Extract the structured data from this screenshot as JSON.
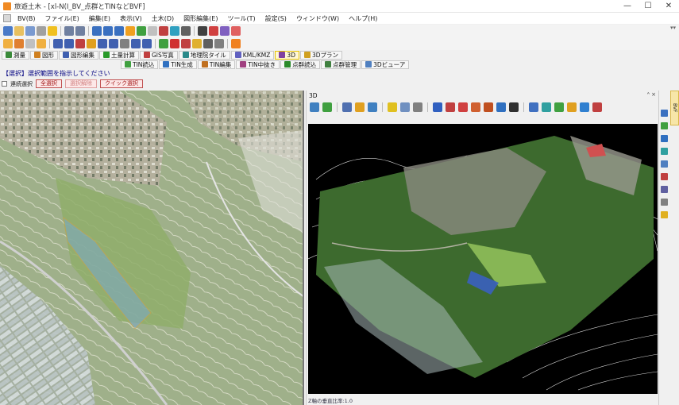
{
  "window": {
    "title": "旅遊土木 - [xl-N(I_BV_点群とTINなどBVF]",
    "minimize": "—",
    "maximize": "☐",
    "close": "✕"
  },
  "menu": [
    "BV(B)",
    "ファイル(E)",
    "編集(E)",
    "表示(V)",
    "土木(D)",
    "図形編集(E)",
    "ツール(T)",
    "設定(S)",
    "ウィンドウ(W)",
    "ヘルプ(H)"
  ],
  "tabs_row1": [
    {
      "label": "測量",
      "icon_color": "#3a8a3a"
    },
    {
      "label": "図形",
      "icon_color": "#d08020"
    },
    {
      "label": "図形編集",
      "icon_color": "#4060b0"
    },
    {
      "label": "土量計算",
      "icon_color": "#2a9a2a"
    },
    {
      "label": "GIS写真",
      "icon_color": "#c04040"
    },
    {
      "label": "地理院タイル",
      "icon_color": "#2a8a8a"
    },
    {
      "label": "KML/KMZ",
      "icon_color": "#6060c0"
    },
    {
      "label": "3D",
      "icon_color": "#8040a0"
    },
    {
      "label": "3Dプラン",
      "icon_color": "#d0a020"
    }
  ],
  "tabs_row2": [
    {
      "label": "TIN読込",
      "icon_color": "#40a040"
    },
    {
      "label": "TIN生成",
      "icon_color": "#3070c0"
    },
    {
      "label": "TIN編集",
      "icon_color": "#c07020"
    },
    {
      "label": "TIN中抜き",
      "icon_color": "#a04080"
    },
    {
      "label": "点群読込",
      "icon_color": "#2a8a2a"
    },
    {
      "label": "点群管理",
      "icon_color": "#408040"
    },
    {
      "label": "3Dビューア",
      "icon_color": "#5080c0"
    }
  ],
  "prompt": "【選択】選択範囲を指示してください",
  "selection": {
    "checkbox_label": "連続選択",
    "all_select": "全選択",
    "deselect": "選択解除",
    "quick_select": "クイック選択"
  },
  "panel3d": {
    "title": "3D",
    "controls": "ᴬ ×",
    "status": "Z軸の垂直比率:1.0"
  },
  "side_tab_label": "BVF",
  "colors": {
    "accent": "#f08a24",
    "prompt": "#000080",
    "select_button": "#a01010"
  }
}
